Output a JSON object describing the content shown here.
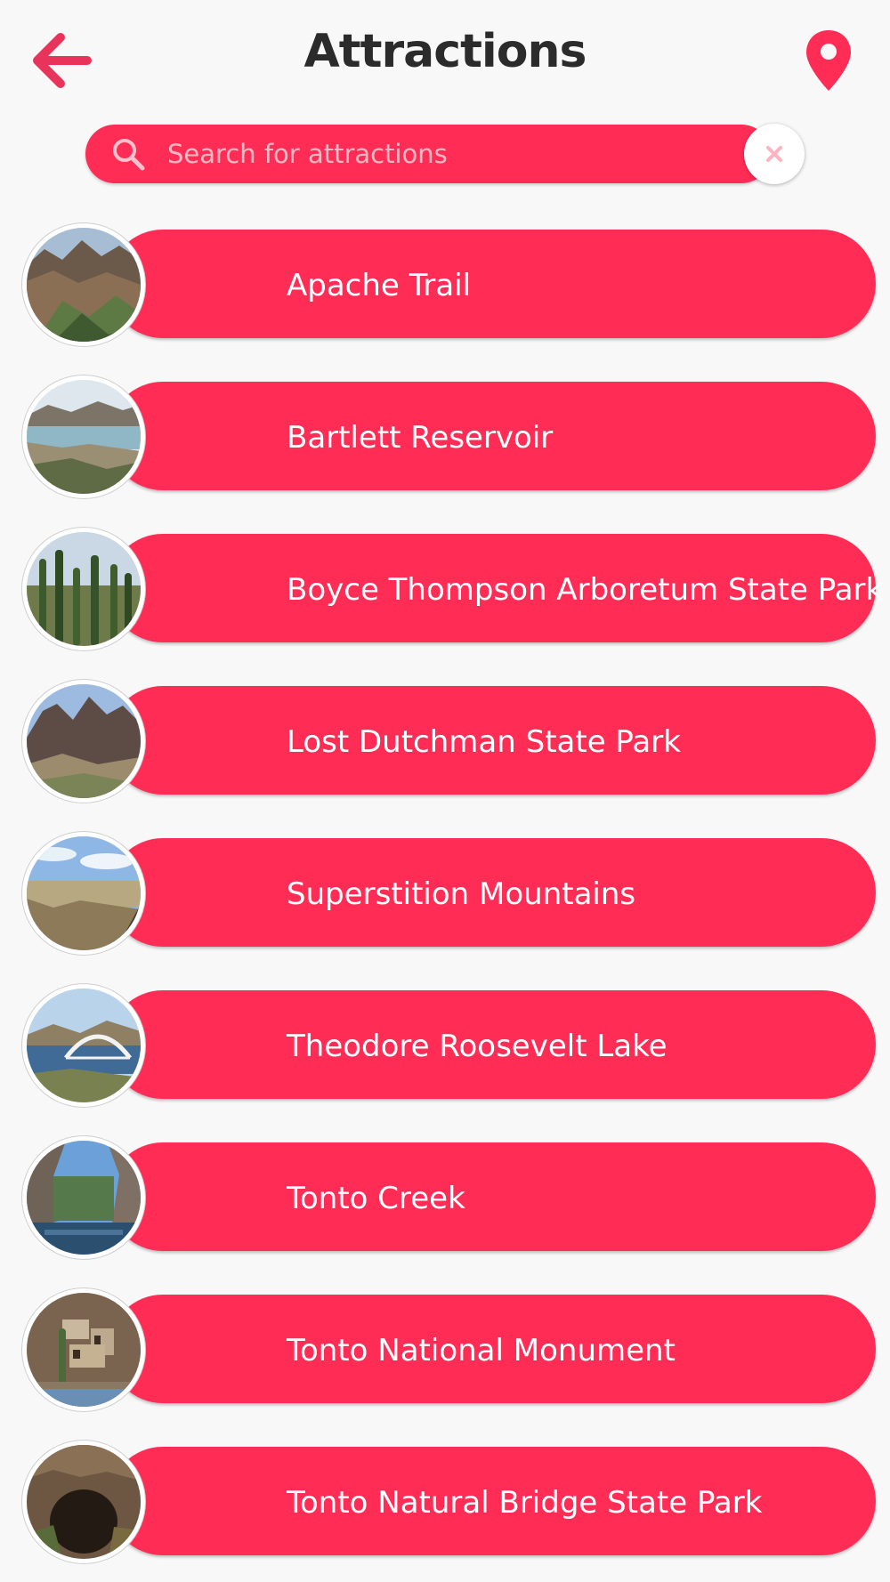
{
  "header": {
    "title": "Attractions",
    "back_icon": "arrow-left-icon",
    "location_icon": "map-pin-icon"
  },
  "search": {
    "placeholder": "Search for attractions",
    "value": "",
    "search_icon": "search-icon",
    "clear_icon": "close-icon"
  },
  "colors": {
    "accent": "#ff2d55",
    "background": "#f8f8f9",
    "title": "#2b2b2b"
  },
  "attractions": [
    {
      "name": "Apache Trail",
      "thumb": "canyon-valley-photo"
    },
    {
      "name": "Bartlett Reservoir",
      "thumb": "reservoir-lake-photo"
    },
    {
      "name": "Boyce Thompson Arboretum State Park",
      "thumb": "cactus-garden-photo"
    },
    {
      "name": "Lost Dutchman State Park",
      "thumb": "mountain-cliff-photo"
    },
    {
      "name": "Superstition Mountains",
      "thumb": "desert-vista-photo"
    },
    {
      "name": "Theodore Roosevelt Lake",
      "thumb": "lake-bridge-photo"
    },
    {
      "name": "Tonto Creek",
      "thumb": "creek-canyon-photo"
    },
    {
      "name": "Tonto National Monument",
      "thumb": "cliff-dwelling-photo"
    },
    {
      "name": "Tonto Natural Bridge State Park",
      "thumb": "natural-bridge-cave-photo"
    }
  ]
}
